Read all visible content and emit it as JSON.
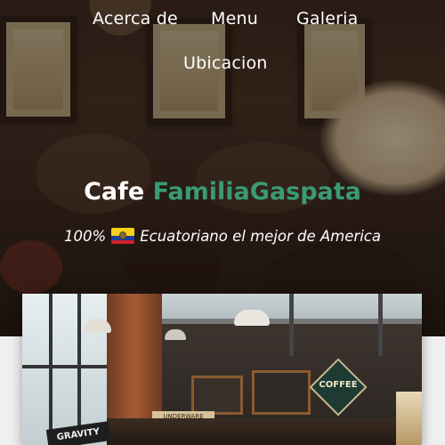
{
  "nav": {
    "items": [
      {
        "label": "Acerca de"
      },
      {
        "label": "Menu"
      },
      {
        "label": "Galeria"
      },
      {
        "label": "Ubicacion"
      }
    ]
  },
  "hero": {
    "title_bold": "Cafe",
    "title_brand": "FamiliaGaspata",
    "tagline_prefix": "100%",
    "tagline_suffix": "Ecuatoriano el mejor de America",
    "flag_icon": "ecuador-flag-icon"
  },
  "photo": {
    "sign_text": "COFFEE",
    "shelf_sign": "UNDERWARE",
    "chalk_board": "GRAVITY"
  },
  "colors": {
    "brand_green": "#3a9a74",
    "nav_text": "#ffffff",
    "hero_dark": "#2a1d15",
    "page_bg": "#efefef"
  }
}
